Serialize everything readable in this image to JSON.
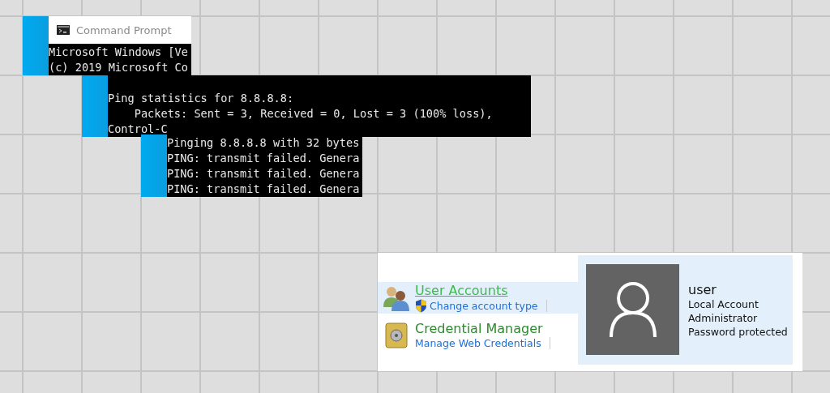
{
  "terminals": [
    {
      "title": "Command Prompt",
      "lines": [
        "Microsoft Windows [Ve",
        "(c) 2019 Microsoft Co"
      ]
    },
    {
      "lines": [
        "Ping statistics for 8.8.8.8:",
        "    Packets: Sent = 3, Received = 0, Lost = 3 (100% loss),",
        "Control-C"
      ]
    },
    {
      "lines": [
        "Pinging 8.8.8.8 with 32 bytes",
        "PING: transmit failed. Genera",
        "PING: transmit failed. Genera",
        "PING: transmit failed. Genera"
      ]
    }
  ],
  "control_panel": {
    "items": [
      {
        "kind": "users",
        "title": "User Accounts",
        "link": "Change account type",
        "shield": true,
        "selected": true
      },
      {
        "kind": "safe",
        "title": "Credential Manager",
        "link": "Manage Web Credentials",
        "shield": false,
        "selected": false
      }
    ]
  },
  "user_card": {
    "name": "user",
    "details": [
      "Local Account",
      "Administrator",
      "Password protected"
    ]
  }
}
